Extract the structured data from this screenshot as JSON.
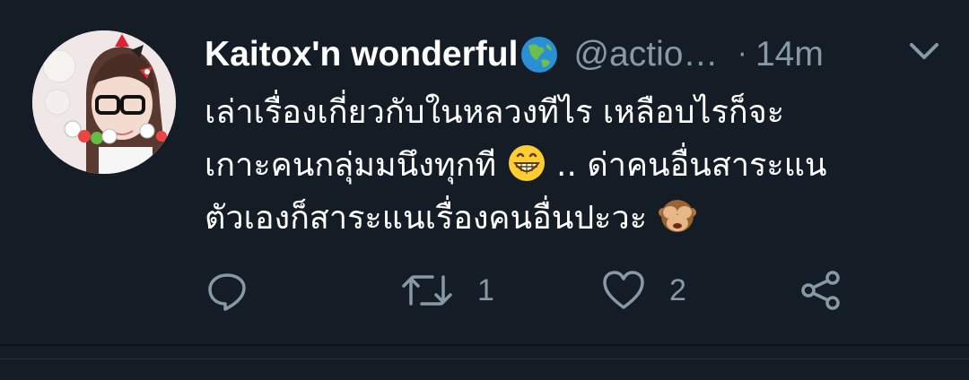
{
  "tweet": {
    "author_name": "Kaitox'n wonderful",
    "author_emoji": "globe-asia-australia-icon",
    "handle": "@actio…",
    "separator": "·",
    "time": "14m",
    "lines": [
      {
        "text": "เล่าเรื่องเกี่ยวกับในหลวงทีไร เหลือบไรก็จะ",
        "emoji": null,
        "after": ""
      },
      {
        "text": "เกาะคนกลุ่มมนึงทุกที ",
        "emoji": "grinning-face-icon",
        "after": ".. ด่าคนอื่นสาระแน"
      },
      {
        "text": "ตัวเองก็สาระแนเรื่องคนอื่นปะวะ ",
        "emoji": "see-no-evil-monkey-icon",
        "after": ""
      }
    ],
    "actions": {
      "reply_count": "",
      "retweet_count": "1",
      "like_count": "2"
    }
  },
  "colors": {
    "background": "#141d26",
    "text": "#ffffff",
    "muted": "#8899a6",
    "divider": "#0c1117"
  }
}
